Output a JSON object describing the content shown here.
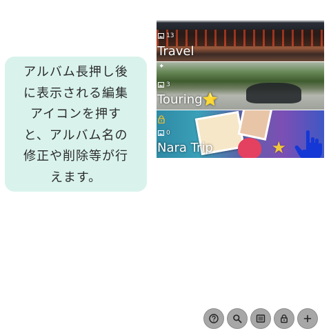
{
  "hint": {
    "lines": [
      "アルバム長押し後",
      "に表示される編集",
      "アイコンを押す",
      "と、アルバム名の",
      "修正や削除等が行",
      "えます。"
    ]
  },
  "albums": [
    {
      "title": "Travel",
      "photo_count": "13",
      "locked": false,
      "icon": "photo-icon"
    },
    {
      "title": "Touring⭐",
      "photo_count": "3",
      "locked": false,
      "icon": "photo-icon"
    },
    {
      "title": "Nara Trip",
      "photo_count": "0",
      "locked": true,
      "icon": "photo-icon"
    }
  ],
  "edit_icon": {
    "glyph": "★",
    "color": "#f3c73c"
  },
  "pointer": {
    "color": "#1537d6",
    "icon": "hand-pointer-icon"
  },
  "toolbar": {
    "buttons": [
      {
        "icon": "help-icon",
        "glyph": "?"
      },
      {
        "icon": "search-icon",
        "glyph": "⌕"
      },
      {
        "icon": "list-icon",
        "glyph": "▤"
      },
      {
        "icon": "lock-icon",
        "glyph": "🔒"
      },
      {
        "icon": "add-icon",
        "glyph": "+"
      }
    ]
  }
}
